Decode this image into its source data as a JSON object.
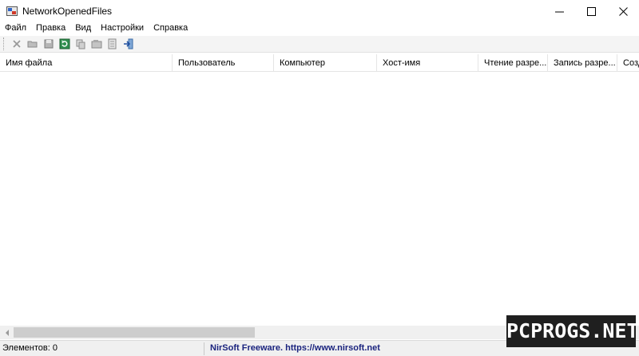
{
  "window": {
    "title": "NetworkOpenedFiles",
    "icon": "network-files-app-icon"
  },
  "menu": {
    "items": [
      "Файл",
      "Правка",
      "Вид",
      "Настройки",
      "Справка"
    ]
  },
  "toolbar": {
    "buttons": [
      "delete-icon",
      "open-folder-icon",
      "save-icon",
      "refresh-icon",
      "copy-icon",
      "properties-icon",
      "html-report-icon",
      "exit-icon"
    ]
  },
  "columns": [
    "Имя файла",
    "Пользователь",
    "Компьютер",
    "Хост-имя",
    "Чтение разре...",
    "Запись разре...",
    "Созд"
  ],
  "rows": [],
  "status": {
    "items_label": "Элементов: 0",
    "credit": "NirSoft Freeware. https://www.nirsoft.net"
  },
  "watermark": {
    "text": "PCPROGS.NET"
  },
  "colors": {
    "credit_text": "#1a237e",
    "watermark_bg": "#1f1f1f"
  }
}
